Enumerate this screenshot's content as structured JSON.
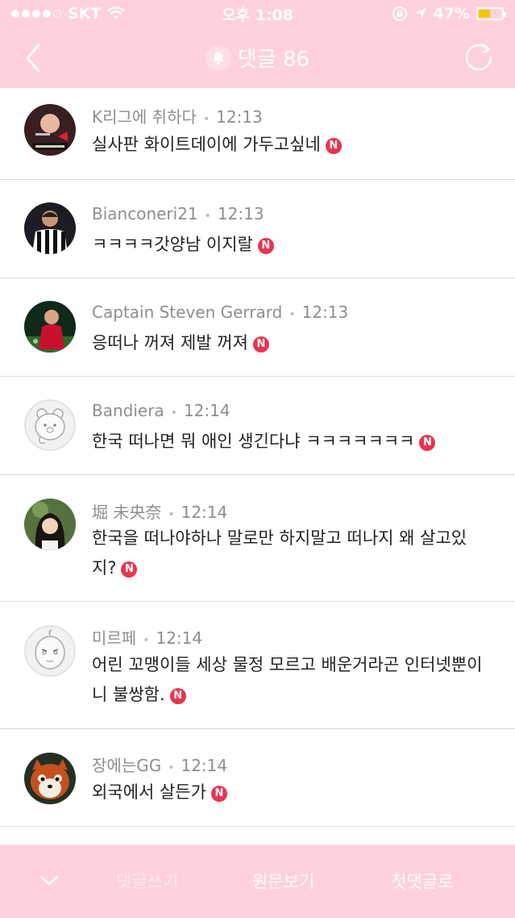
{
  "status_bar": {
    "carrier": "SKT",
    "time": "오후 1:08",
    "battery": "47%",
    "battery_color": "#f7c600"
  },
  "header": {
    "title": "댓글 86",
    "back_icon": "chevron-left-icon",
    "refresh_icon": "refresh-icon",
    "bell_icon": "bell-icon"
  },
  "comments": [
    {
      "author": "K리그에 취하다",
      "time": "12:13",
      "text": "실사판 화이트데이에 가두고싶네",
      "new": "N"
    },
    {
      "author": "Bianconeri21",
      "time": "12:13",
      "text": "ㅋㅋㅋㅋ갓양남 이지랄",
      "new": "N"
    },
    {
      "author": "Captain Steven Gerrard",
      "time": "12:13",
      "text": "응떠나 꺼져 제발 꺼져",
      "new": "N"
    },
    {
      "author": "Bandiera",
      "time": "12:14",
      "text": "한국 떠나면 뭐 애인 생긴다냐 ㅋㅋㅋㅋㅋㅋㅋ",
      "new": "N"
    },
    {
      "author": "堀 未央奈",
      "time": "12:14",
      "text": "한국을 떠나야하나 말로만 하지말고 떠나지 왜 살고있지?",
      "new": "N"
    },
    {
      "author": "미르페",
      "time": "12:14",
      "text": "어린 꼬맹이들 세상 물정 모르고 배운거라곤 인터넷뿐이니 불쌍함.",
      "new": "N"
    },
    {
      "author": "장에는GG",
      "time": "12:14",
      "text": "외국에서 살든가",
      "new": "N"
    }
  ],
  "bottom_bar": {
    "write_comment": "댓글쓰기",
    "view_original": "원문보기",
    "first_comment": "첫댓글로"
  },
  "colors": {
    "accent": "#ffd1dc",
    "new_badge": "#e8344f"
  }
}
